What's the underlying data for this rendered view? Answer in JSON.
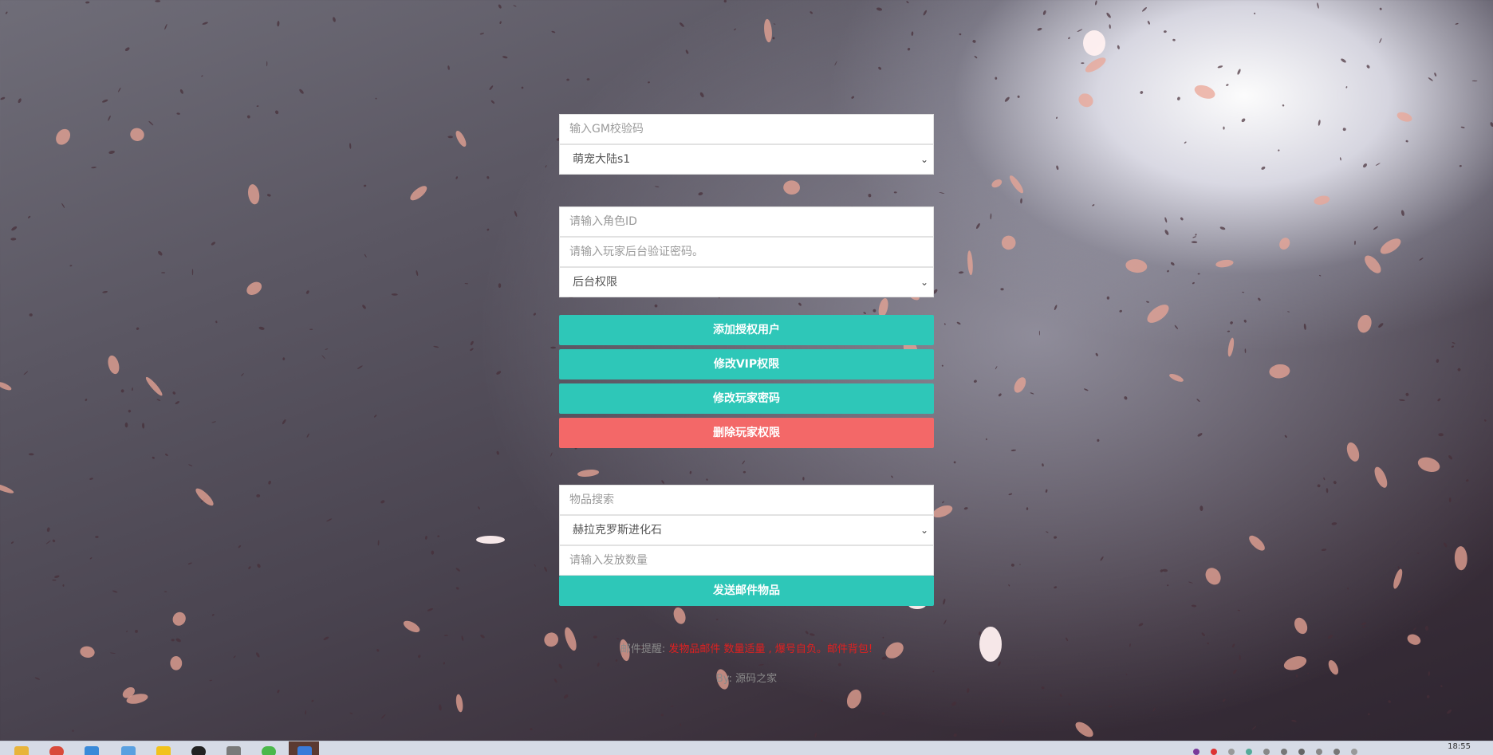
{
  "form": {
    "gm_code_placeholder": "输入GM校验码",
    "server_selected": "萌宠大陆s1",
    "role_id_placeholder": "请输入角色ID",
    "player_pwd_placeholder": "请输入玩家后台验证密码。",
    "permission_selected": "后台权限",
    "item_search_placeholder": "物品搜索",
    "item_selected": "赫拉克罗斯进化石",
    "quantity_placeholder": "请输入发放数量"
  },
  "buttons": {
    "add_user": "添加授权用户",
    "modify_vip": "修改VIP权限",
    "modify_pwd": "修改玩家密码",
    "delete_perm": "删除玩家权限",
    "send_mail": "发送邮件物品"
  },
  "notice": {
    "prefix": "邮件提醒: ",
    "warning": "发物品邮件 数量适量 , 爆号自负。邮件背包!"
  },
  "footer": {
    "text": "By: 源码之家"
  },
  "taskbar": {
    "clock": "18:55"
  },
  "colors": {
    "teal_button": "#2ec7b8",
    "red_button": "#f36868",
    "warning_text": "#e02020"
  }
}
